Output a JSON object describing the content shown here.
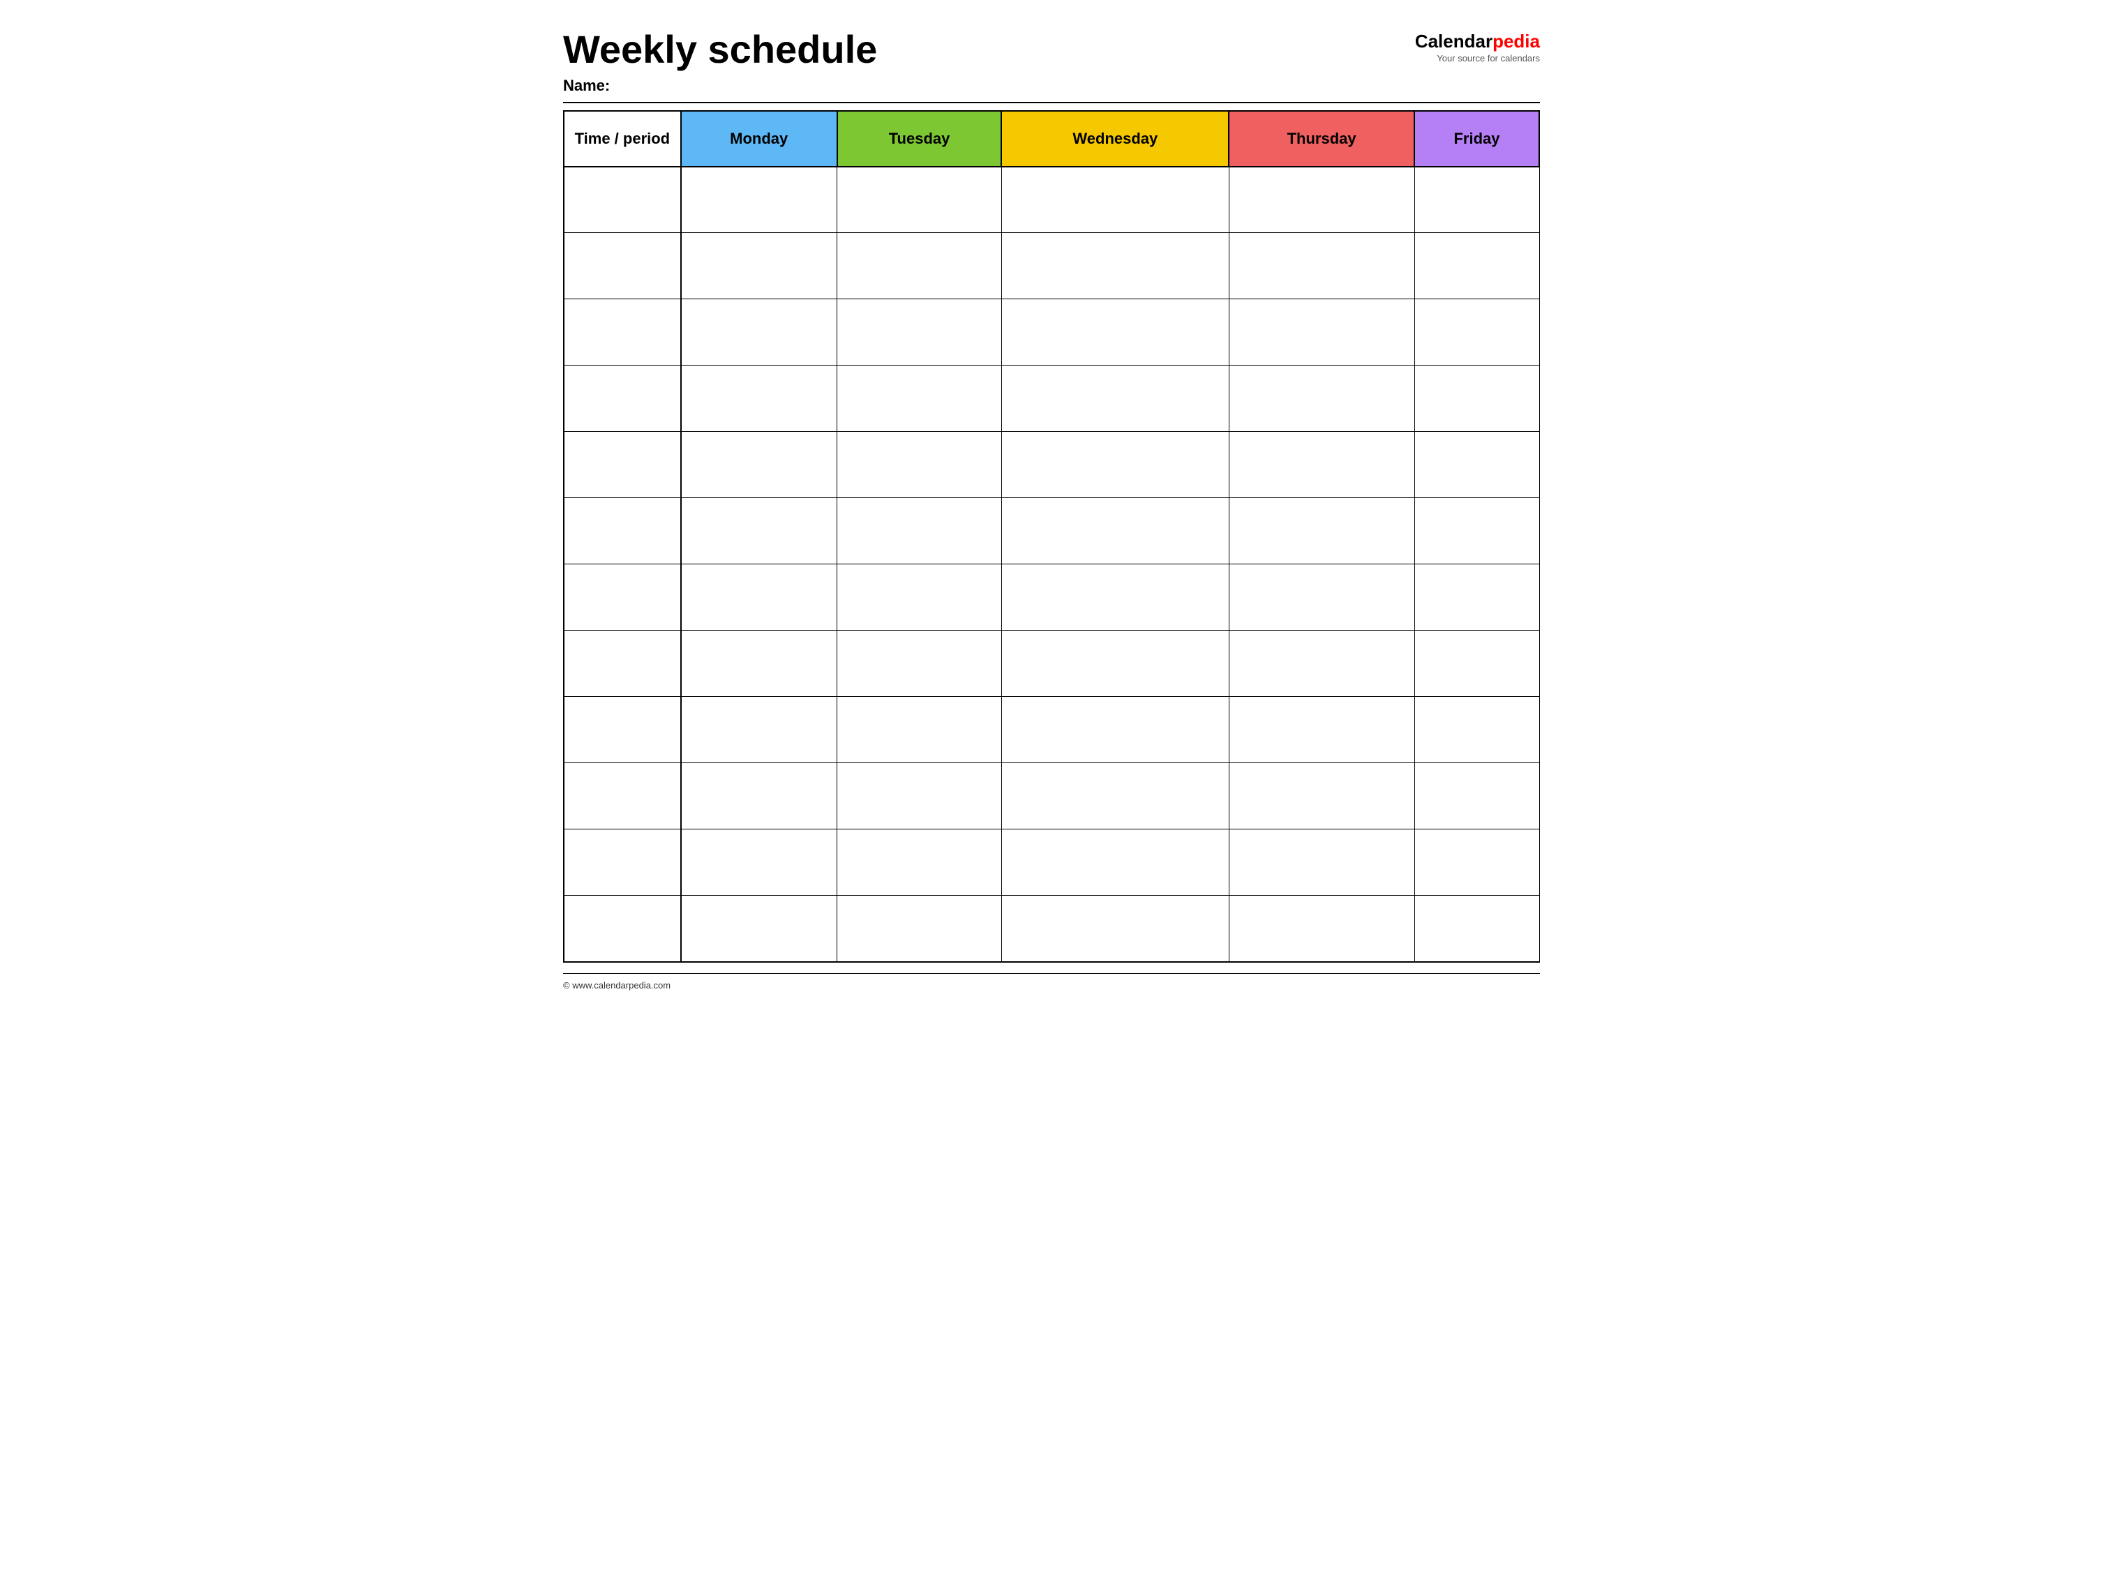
{
  "header": {
    "title": "Weekly schedule",
    "name_label": "Name:",
    "logo": {
      "brand_part1": "Calendar",
      "brand_part2": "pedia",
      "tagline": "Your source for calendars"
    }
  },
  "table": {
    "columns": [
      {
        "label": "Time / period",
        "class": "time-header"
      },
      {
        "label": "Monday",
        "class": "monday-header"
      },
      {
        "label": "Tuesday",
        "class": "tuesday-header"
      },
      {
        "label": "Wednesday",
        "class": "wednesday-header"
      },
      {
        "label": "Thursday",
        "class": "thursday-header"
      },
      {
        "label": "Friday",
        "class": "friday-header"
      }
    ],
    "row_count": 12
  },
  "footer": {
    "text": "© www.calendarpedia.com"
  }
}
